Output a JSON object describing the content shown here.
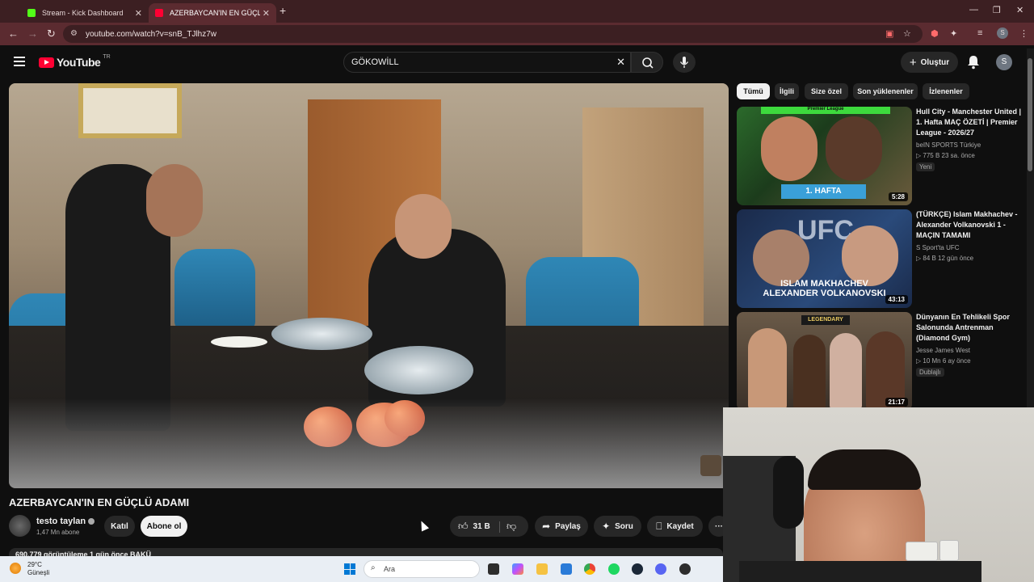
{
  "browser": {
    "tabs": [
      {
        "label": "Stream - Kick Dashboard",
        "color": "#53fc18"
      },
      {
        "label": "AZERBAYCAN'IN EN GÜÇLÜ AD",
        "color": "#ff0033"
      }
    ],
    "url": "youtube.com/watch?v=snB_TJlhz7w",
    "profile_initial": "S"
  },
  "header": {
    "logo_text": "YouTube",
    "country": "TR",
    "search_value": "GÖKOWİLL",
    "create_label": "Oluştur",
    "avatar_initial": "S"
  },
  "video": {
    "title": "AZERBAYCAN'IN EN GÜÇLÜ ADAMI",
    "channel": "testo taylan",
    "subscribers": "1,47 Mn abone",
    "join_label": "Katıl",
    "subscribe_label": "Abone ol",
    "likes": "31 B",
    "share_label": "Paylaş",
    "ask_label": "Soru",
    "save_label": "Kaydet",
    "description_preview": "690.779 görüntüleme  1 gün önce  BAKÜ"
  },
  "chips": [
    "Tümü",
    "İlgili",
    "Size özel",
    "Son yüklenenler",
    "İzlenenler"
  ],
  "related": [
    {
      "title": "Hull City - Manchester United | 1. Hafta MAÇ ÖZETİ | Premier League - 2026/27",
      "channel": "beIN SPORTS Türkiye",
      "meta": "▷ 775 B   23 sa. önce",
      "badge": "Yeni",
      "duration": "5:28",
      "thumb_caption": "1. HAFTA",
      "thumb_top": "Premier League"
    },
    {
      "title": "(TÜRKÇE) Islam Makhachev - Alexander Volkanovski 1 - MAÇIN TAMAMI",
      "channel": "S Sport'ta UFC",
      "meta": "▷ 84 B   12 gün önce",
      "duration": "43:13",
      "thumb_caption": "ISLAM MAKHACHEV",
      "thumb_caption2": "ALEXANDER VOLKANOVSKI",
      "thumb_top": "UFC"
    },
    {
      "title": "Dünyanın En Tehlikeli Spor Salonunda Antrenman (Diamond Gym)",
      "channel": "Jesse James West",
      "meta": "▷ 10 Mn   6 ay önce",
      "badge": "Dublajlı",
      "duration": "21:17",
      "thumb_top": "LEGENDARY"
    }
  ],
  "taskbar": {
    "temperature": "29°C",
    "weather": "Güneşli",
    "search_placeholder": "Ara"
  }
}
